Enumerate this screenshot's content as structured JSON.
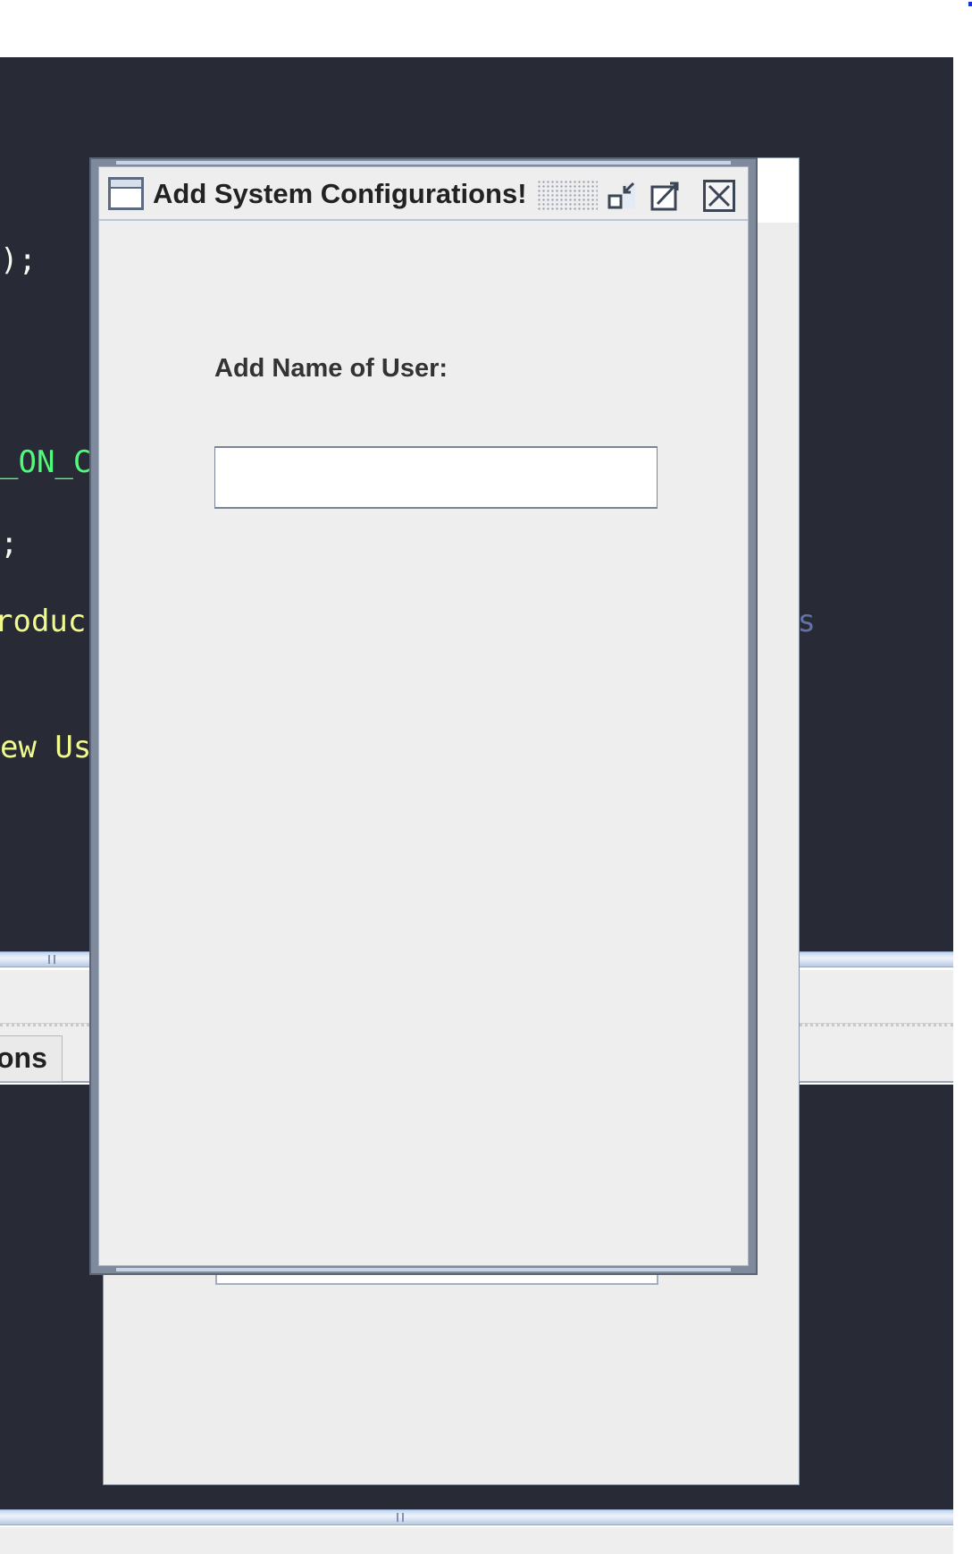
{
  "editor": {
    "lines": [
      ");",
      "_ON_C",
      ";",
      "roduc",
      "cs",
      "ew Us"
    ]
  },
  "tabs": {
    "options_label": "ons"
  },
  "dialog": {
    "title": "Add System Configurations!",
    "icon": "window-icon",
    "buttons": [
      "iconify-icon",
      "maximize-icon",
      "close-icon"
    ],
    "name_label": "Add Name of User:",
    "name_value": "",
    "name_placeholder": ""
  },
  "colors": {
    "editor_bg": "#282a36",
    "code_white": "#f8f8f2",
    "code_green": "#50fa7b",
    "code_yellow": "#f1fa8c",
    "code_comment": "#6272a4",
    "dialog_bg": "#eeeeee",
    "frame_border": "#7f8a9c"
  }
}
